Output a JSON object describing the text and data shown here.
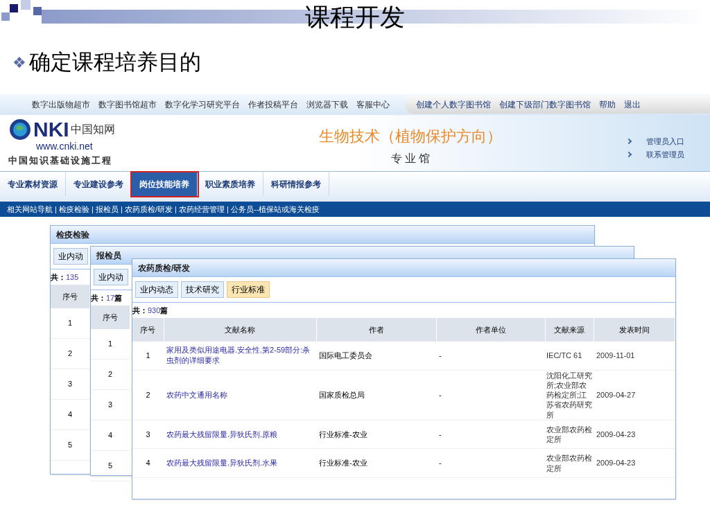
{
  "slide": {
    "title": "课程开发",
    "bullet_marker": "❖",
    "bullet_text": "确定课程培养目的"
  },
  "site": {
    "top_links": [
      "数字出版物超市",
      "数字图书馆超市",
      "数字化学习研究平台",
      "作者投稿平台",
      "浏览器下载",
      "客服中心"
    ],
    "account_links": [
      "创建个人数字图书馆",
      "创建下级部门数字图书馆",
      "帮助",
      "退出"
    ],
    "logo": {
      "mark": "NKI",
      "name": "中国知网",
      "url": "www.cnki.net",
      "tagline": "中国知识基础设施工程"
    },
    "banner": {
      "title": "生物技术（植物保护方向）",
      "subtitle": "专 业 馆"
    },
    "admin_links": [
      "管理员入口",
      "联系管理员"
    ],
    "main_tabs": [
      {
        "label": "专业素材资源",
        "selected": false
      },
      {
        "label": "专业建设参考",
        "selected": false
      },
      {
        "label": "岗位技能培养",
        "selected": true
      },
      {
        "label": "职业素质培养",
        "selected": false
      },
      {
        "label": "科研情报参考",
        "selected": false
      }
    ],
    "sub_nav": "相关网站导航 | 检疫检验 | 报检员 | 农药质检/研发 | 农药经营管理 | 公务员--植保站或海关检疫"
  },
  "windows": [
    {
      "title": "检疫检验",
      "tabs": [
        {
          "label": "业内动",
          "selected": false
        }
      ],
      "count_label": "共：",
      "count": "135",
      "columns": [
        "序号"
      ],
      "rows": [
        {
          "no": "1"
        },
        {
          "no": "2"
        },
        {
          "no": "3"
        },
        {
          "no": "4"
        },
        {
          "no": "5"
        }
      ]
    },
    {
      "title": "报检员",
      "tabs": [
        {
          "label": "业内动",
          "selected": false
        }
      ],
      "count_label": "共：",
      "count": "17",
      "count_unit": "篇",
      "columns": [
        "序号"
      ],
      "rows": [
        {
          "no": "1"
        },
        {
          "no": "2"
        },
        {
          "no": "3"
        },
        {
          "no": "4"
        },
        {
          "no": "5"
        }
      ]
    },
    {
      "title": "农药质检/研发",
      "tabs": [
        {
          "label": "业内动态",
          "selected": false
        },
        {
          "label": "技术研究",
          "selected": false
        },
        {
          "label": "行业标准",
          "selected": true
        }
      ],
      "count_label": "共：",
      "count": "930",
      "count_unit": "篇",
      "columns": [
        "序号",
        "文献名称",
        "作者",
        "作者单位",
        "文献来源",
        "发表时间"
      ],
      "rows": [
        {
          "no": "1",
          "title": "家用及类似用途电器.安全性.第2-59部分:杀虫剂的详细要求",
          "author": "国际电工委员会",
          "unit": "-",
          "source": "IEC/TC 61",
          "date": "2009-11-01"
        },
        {
          "no": "2",
          "title": "农药中文通用名称",
          "author": "国家质检总局",
          "unit": "-",
          "source": "沈阳化工研究所;农业部农药检定所;江苏省农药研究所",
          "date": "2009-04-27"
        },
        {
          "no": "3",
          "title": "农药最大残留限量.异狄氏剂.原粮",
          "author": "行业标准-农业",
          "unit": "-",
          "source": "农业部农药检定所",
          "date": "2009-04-23"
        },
        {
          "no": "4",
          "title": "农药最大残留限量.异狄氏剂.水果",
          "author": "行业标准-农业",
          "unit": "-",
          "source": "农业部农药检定所",
          "date": "2009-04-23"
        }
      ]
    }
  ]
}
